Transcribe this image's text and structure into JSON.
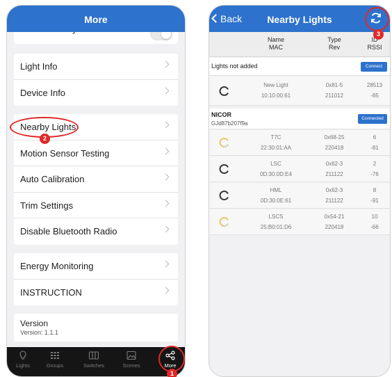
{
  "left": {
    "title": "More",
    "partial_row": "Circadian Rhythms",
    "group1": [
      "Light Info",
      "Device Info"
    ],
    "group2": [
      "Nearby Lights",
      "Motion Sensor Testing",
      "Auto Calibration",
      "Trim Settings",
      "Disable Bluetooth Radio"
    ],
    "group3": [
      "Energy Monitoring",
      "INSTRUCTION"
    ],
    "version_title": "Version",
    "version_value": "Version: 1.1.1",
    "tabs": [
      {
        "label": "Lights",
        "icon": "bulb-icon"
      },
      {
        "label": "Groups",
        "icon": "grid-icon"
      },
      {
        "label": "Switches",
        "icon": "switch-icon"
      },
      {
        "label": "Scenes",
        "icon": "image-icon"
      },
      {
        "label": "More",
        "icon": "share-icon"
      }
    ],
    "badge_1": "1",
    "badge_2": "2"
  },
  "right": {
    "back_label": "Back",
    "title": "Nearby Lights",
    "badge_3": "3",
    "headers": {
      "name": "Name",
      "mac": "MAC",
      "type": "Type",
      "rev": "Rev",
      "id": "ID",
      "rssi": "RSSI"
    },
    "section1": {
      "title": "Lights not added",
      "button": "Connect",
      "rows": [
        {
          "name": "New Light",
          "mac": "10:10:00:61",
          "type": "0x81-5",
          "rev": "211012",
          "id": "28513",
          "rssi": "-85"
        }
      ]
    },
    "section2": {
      "title": "NICOR",
      "subtitle": "GJd87b207f9a",
      "button": "Connected",
      "rows": [
        {
          "name": "T7C",
          "mac": "22:30:01:AA",
          "type": "0x68-25",
          "rev": "220418",
          "id": "6",
          "rssi": "-81"
        },
        {
          "name": "LSC",
          "mac": "0D:30:0D:E4",
          "type": "0x62-3",
          "rev": "211122",
          "id": "2",
          "rssi": "-76"
        },
        {
          "name": "HML",
          "mac": "0D:30:0E:61",
          "type": "0x62-3",
          "rev": "211122",
          "id": "8",
          "rssi": "-91"
        },
        {
          "name": "LSCS",
          "mac": "25:B0:01:D6",
          "type": "0x54-21",
          "rev": "220418",
          "id": "10",
          "rssi": "-66"
        }
      ]
    }
  },
  "colors": {
    "nav_blue": "#2d72cc",
    "annotation_red": "#e02828",
    "tabbar": "#151515"
  }
}
